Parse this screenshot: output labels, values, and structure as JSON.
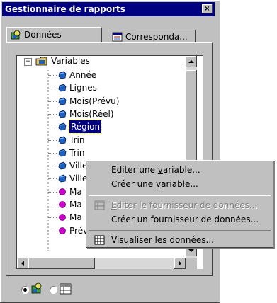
{
  "window": {
    "title": "Gestionnaire de rapports",
    "close_glyph": "×"
  },
  "tabs": [
    {
      "label": "Données",
      "icon": "data-tab-icon",
      "active": true
    },
    {
      "label": "Corresponda...",
      "icon": "correspondence-tab-icon",
      "active": false
    }
  ],
  "tree": {
    "root": {
      "label": "Variables",
      "expand_glyph": "−"
    },
    "items": [
      {
        "label": "Année",
        "icon": "dimension-icon"
      },
      {
        "label": "Lignes",
        "icon": "dimension-icon"
      },
      {
        "label": "Mois(Prévu)",
        "icon": "dimension-icon"
      },
      {
        "label": "Mois(Réel)",
        "icon": "dimension-icon"
      },
      {
        "label": "Région",
        "icon": "dimension-icon",
        "selected": true
      },
      {
        "label": "Trin",
        "icon": "dimension-icon"
      },
      {
        "label": "Trin",
        "icon": "dimension-icon"
      },
      {
        "label": "Ville",
        "icon": "dimension-icon"
      },
      {
        "label": "Ville",
        "icon": "dimension-icon"
      },
      {
        "label": "Ma",
        "icon": "measure-icon"
      },
      {
        "label": "Ma",
        "icon": "measure-icon"
      },
      {
        "label": "Ma",
        "icon": "measure-icon"
      },
      {
        "label": "Prévision du revenu des v",
        "icon": "measure-icon"
      }
    ]
  },
  "context_menu": {
    "items": [
      {
        "pre": "Editer une ",
        "u": "v",
        "post": "ariable...",
        "disabled": false
      },
      {
        "pre": "Créer une ",
        "u": "v",
        "post": "ariable...",
        "disabled": false
      },
      {
        "pre": "",
        "u": "E",
        "post": "diter le fournisseur de données...",
        "disabled": true,
        "icon": "data-provider-icon"
      },
      {
        "pre": "Créer un fournisseur de données...",
        "u": "",
        "post": "",
        "disabled": false
      },
      {
        "pre": "Vis",
        "u": "u",
        "post": "aliser les données...",
        "disabled": false,
        "icon": "table-view-icon"
      }
    ]
  },
  "bottom_radios": [
    {
      "selected": true,
      "icon": "variables-view-icon"
    },
    {
      "selected": false,
      "icon": "providers-view-icon"
    }
  ],
  "colors": {
    "title_bar": "#000080",
    "selection": "#000080",
    "dimension_icon": "#2060c0",
    "measure_icon": "#d000d0"
  }
}
